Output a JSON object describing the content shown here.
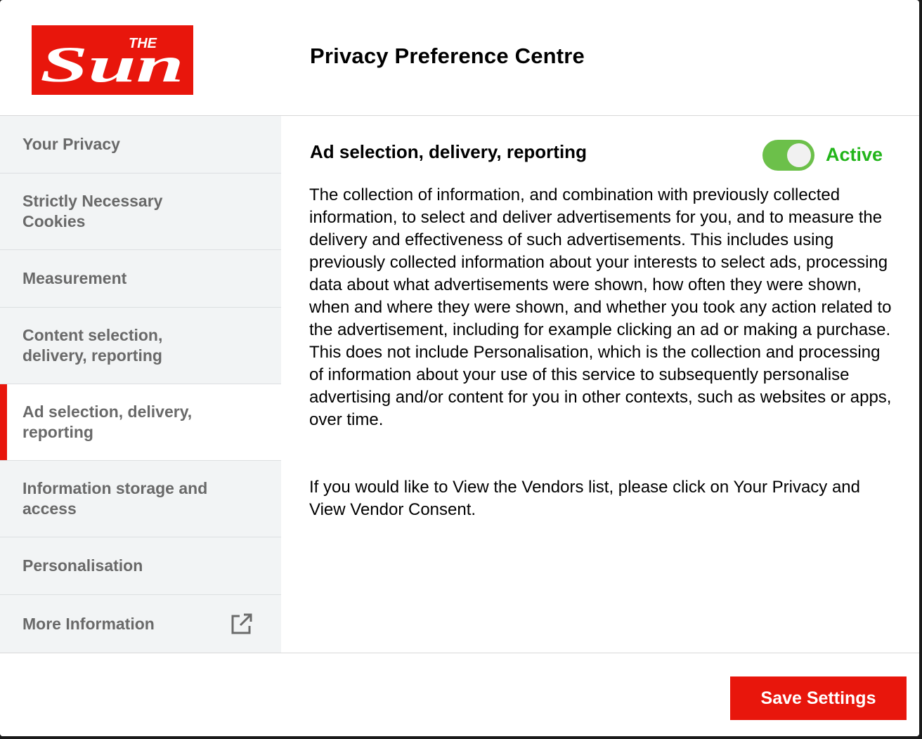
{
  "header": {
    "logo_alt": "The Sun",
    "logo_small_text": "THE",
    "logo_big_text": "Sun",
    "title": "Privacy Preference Centre"
  },
  "sidebar": {
    "items": [
      {
        "label": "Your Privacy",
        "active": false
      },
      {
        "label": "Strictly Necessary Cookies",
        "active": false
      },
      {
        "label": "Measurement",
        "active": false
      },
      {
        "label": "Content selection, delivery, reporting",
        "active": false
      },
      {
        "label": "Ad selection, delivery, reporting",
        "active": true
      },
      {
        "label": "Information storage and access",
        "active": false
      },
      {
        "label": "Personalisation",
        "active": false
      },
      {
        "label": "More Information",
        "active": false,
        "icon": "external-link-icon"
      }
    ]
  },
  "content": {
    "section_title": "Ad selection, delivery, reporting",
    "toggle_state": "on",
    "toggle_label": "Active",
    "description": "The collection of information, and combination with previously collected information, to select and deliver advertisements for you, and to measure the delivery and effectiveness of such advertisements. This includes using previously collected information about your interests to select ads, processing data about what advertisements were shown, how often they were shown, when and where they were shown, and whether you took any action related to the advertisement, including for example clicking an ad or making a purchase. This does not include Personalisation, which is the collection and processing of information about your use of this service to subsequently personalise advertising and/or content for you in other contexts, such as websites or apps, over time.",
    "vendor_note": "If you would like to View the Vendors list, please click on Your Privacy and View Vendor Consent."
  },
  "footer": {
    "save_label": "Save Settings"
  },
  "colors": {
    "brand_red": "#e8160c",
    "toggle_green": "#6cc04a",
    "active_text_green": "#22b51a",
    "sidebar_bg": "#f2f4f5",
    "sidebar_text": "#696969"
  }
}
